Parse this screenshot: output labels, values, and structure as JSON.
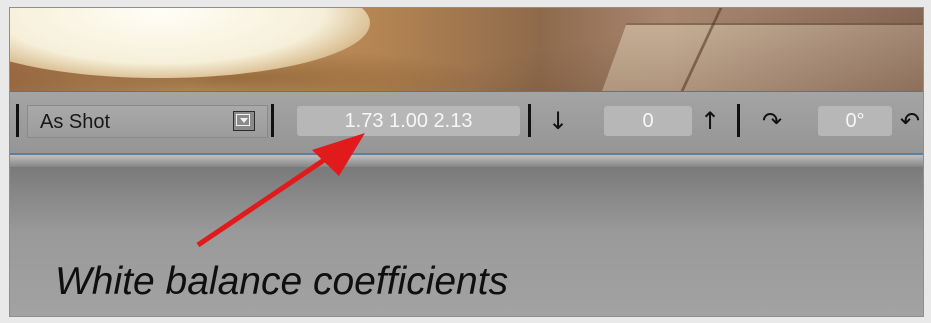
{
  "toolbar": {
    "white_balance_preset": "As Shot",
    "wb_coefficients": "1.73 1.00 2.13",
    "exposure_value": "0",
    "rotation_value": "0°"
  },
  "annotation": {
    "caption": "White balance coefficients",
    "arrow_color": "#e11b1b"
  },
  "icons": [
    "chevron-down-icon",
    "arrow-down-icon",
    "arrow-up-icon",
    "rotate-right-icon",
    "rotate-left-icon"
  ]
}
